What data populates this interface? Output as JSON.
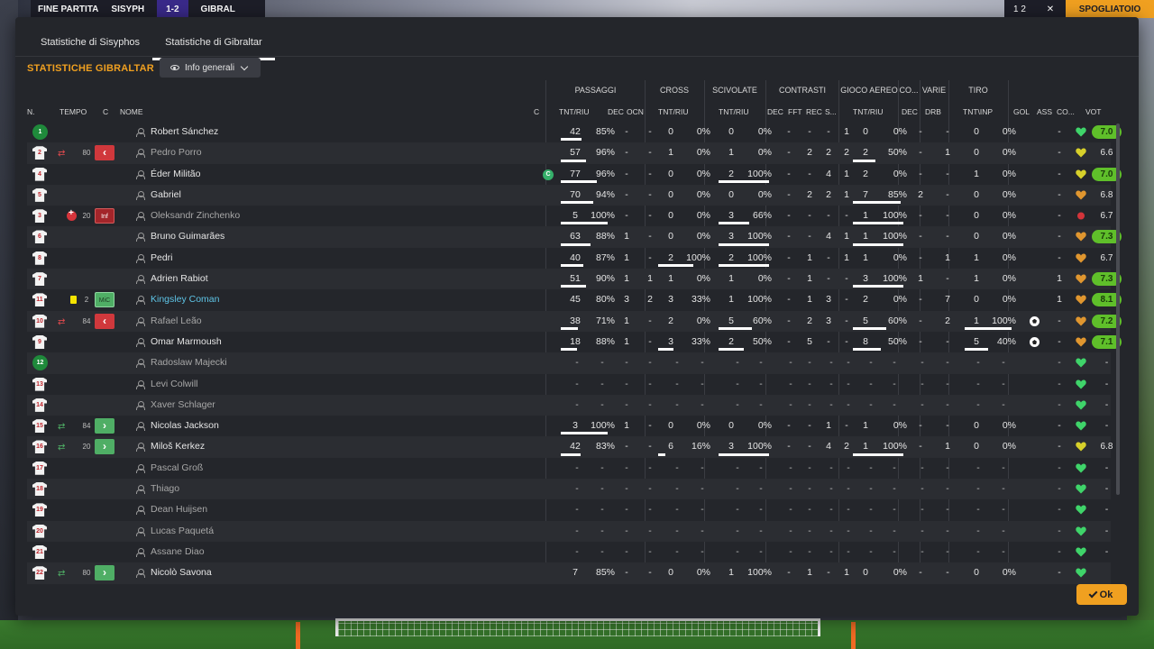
{
  "topbar": {
    "left_label": "FINE PARTITA",
    "home_team_short": "SISYPH",
    "score": "1-2",
    "away_team_short": "GIBRAL",
    "right_counter": "1 2",
    "close_label": "✕",
    "action_label": "SPOGLIATOIO"
  },
  "tabs": [
    {
      "label": "Statistiche di Sisyphos",
      "active": false
    },
    {
      "label": "Statistiche di Gibraltar",
      "active": true
    }
  ],
  "section_title": "STATISTICHE GIBRALTAR",
  "view_dropdown": {
    "label": "Info generali"
  },
  "group_headers": {
    "passaggi": "PASSAGGI",
    "cross": "CROSS",
    "scivolate": "SCIVOLATE",
    "contrasti": "CONTRASTI",
    "gioco_aereo": "GIOCO AEREO",
    "co": "CO...",
    "varie": "VARIE",
    "tiro": "TIRO"
  },
  "columns": {
    "n": "N.",
    "tempo": "TEMPO",
    "c": "C",
    "nome": "NOME",
    "c2": "C",
    "pass_tnt": "TNT/RIU",
    "pass_dec": "DEC",
    "pass_ocn": "OCN",
    "cross_tnt": "TNT/RIU",
    "sciv_tnt": "TNT/RIU",
    "contr_dec": "DEC",
    "contr_fft": "FFT",
    "contr_rec": "REC",
    "contr_s": "S...",
    "aereo_tnt": "TNT/RIU",
    "co_dec": "DEC",
    "varie_drb": "DRB",
    "tiro_tnt": "TNT\\INP",
    "gol": "GOL",
    "ass": "ASS",
    "co2": "CO...",
    "vot": "VOT"
  },
  "players": [
    {
      "num": "1",
      "gk": true,
      "tempo": "",
      "sub": "",
      "c": "",
      "name": "Robert Sánchez",
      "dim": false,
      "p_t": "42",
      "p_p": "85%",
      "p_bar": 0.42,
      "p_dec": "-",
      "p_ocn": "-",
      "cr_t": "0",
      "cr_p": "0%",
      "sc_t": "0",
      "sc_p": "0%",
      "ct_dec": "-",
      "ct_fft": "-",
      "ct_rec": "-",
      "ct_s": "1",
      "ae_t": "0",
      "ae_p": "0%",
      "co_dec": "-",
      "drb": "-",
      "ti_t": "0",
      "ti_p": "0%",
      "gol": "",
      "ass": "-",
      "heart": "green",
      "vot": "7.0",
      "vot_g": true
    },
    {
      "num": "2",
      "gk": false,
      "tempo": "80",
      "sub": "out",
      "c": "red",
      "name": "Pedro Porro",
      "dim": true,
      "p_t": "57",
      "p_p": "96%",
      "p_bar": 0.5,
      "p_dec": "-",
      "p_ocn": "-",
      "cr_t": "1",
      "cr_p": "0%",
      "sc_t": "1",
      "sc_p": "0%",
      "ct_dec": "-",
      "ct_fft": "2",
      "ct_rec": "2",
      "ct_s": "2",
      "ae_t": "2",
      "ae_p": "50%",
      "ae_bar": 0.4,
      "co_dec": "-",
      "drb": "1",
      "ti_t": "0",
      "ti_p": "0%",
      "gol": "",
      "ass": "-",
      "heart": "yellow",
      "vot": "6.6",
      "vot_g": false
    },
    {
      "num": "4",
      "gk": false,
      "tempo": "",
      "sub": "",
      "c": "",
      "name": "Éder Militão",
      "dim": false,
      "capt": true,
      "p_t": "77",
      "p_p": "96%",
      "p_bar": 0.72,
      "p_dec": "-",
      "p_ocn": "-",
      "cr_t": "0",
      "cr_p": "0%",
      "sc_t": "2",
      "sc_p": "100%",
      "sc_bar": 0.9,
      "ct_dec": "-",
      "ct_fft": "-",
      "ct_rec": "4",
      "ct_s": "1",
      "ae_t": "2",
      "ae_p": "0%",
      "co_dec": "-",
      "drb": "-",
      "ti_t": "1",
      "ti_p": "0%",
      "gol": "",
      "ass": "-",
      "heart": "yellow",
      "vot": "7.0",
      "vot_g": true
    },
    {
      "num": "5",
      "gk": false,
      "tempo": "",
      "sub": "",
      "c": "",
      "name": "Gabriel",
      "dim": false,
      "p_t": "70",
      "p_p": "94%",
      "p_bar": 0.65,
      "p_dec": "-",
      "p_ocn": "-",
      "cr_t": "0",
      "cr_p": "0%",
      "sc_t": "0",
      "sc_p": "0%",
      "ct_dec": "-",
      "ct_fft": "2",
      "ct_rec": "2",
      "ct_s": "1",
      "ae_t": "7",
      "ae_p": "85%",
      "ae_bar": 0.85,
      "co_dec": "2",
      "drb": "-",
      "ti_t": "0",
      "ti_p": "0%",
      "gol": "",
      "ass": "-",
      "heart": "orange",
      "vot": "6.8",
      "vot_g": false
    },
    {
      "num": "3",
      "gk": false,
      "tempo": "20",
      "sub": "inj",
      "c": "inf",
      "name": "Oleksandr Zinchenko",
      "dim": true,
      "p_t": "5",
      "p_p": "100%",
      "p_bar": 0.95,
      "p_dec": "-",
      "p_ocn": "-",
      "cr_t": "0",
      "cr_p": "0%",
      "sc_t": "3",
      "sc_p": "66%",
      "sc_bar": 0.55,
      "ct_dec": "-",
      "ct_fft": "-",
      "ct_rec": "-",
      "ct_s": "-",
      "ae_t": "1",
      "ae_p": "100%",
      "ae_bar": 0.9,
      "co_dec": "-",
      "drb": "-",
      "ti_t": "0",
      "ti_p": "0%",
      "gol": "",
      "ass": "-",
      "heart": "red",
      "vot": "6.7",
      "vot_g": false
    },
    {
      "num": "6",
      "gk": false,
      "tempo": "",
      "sub": "",
      "c": "",
      "name": "Bruno Guimarães",
      "dim": false,
      "p_t": "63",
      "p_p": "88%",
      "p_bar": 0.6,
      "p_dec": "1",
      "p_ocn": "-",
      "cr_t": "0",
      "cr_p": "0%",
      "sc_t": "3",
      "sc_p": "100%",
      "sc_bar": 0.9,
      "ct_dec": "-",
      "ct_fft": "-",
      "ct_rec": "4",
      "ct_s": "1",
      "ae_t": "1",
      "ae_p": "100%",
      "ae_bar": 0.9,
      "co_dec": "-",
      "drb": "-",
      "ti_t": "0",
      "ti_p": "0%",
      "gol": "",
      "ass": "-",
      "heart": "orange",
      "vot": "7.3",
      "vot_g": true
    },
    {
      "num": "8",
      "gk": false,
      "tempo": "",
      "sub": "",
      "c": "",
      "name": "Pedri",
      "dim": false,
      "p_t": "40",
      "p_p": "87%",
      "p_bar": 0.45,
      "p_dec": "1",
      "p_ocn": "-",
      "cr_t": "2",
      "cr_p": "100%",
      "cr_bar": 0.7,
      "sc_t": "2",
      "sc_p": "100%",
      "sc_bar": 0.9,
      "ct_dec": "-",
      "ct_fft": "1",
      "ct_rec": "-",
      "ct_s": "1",
      "ae_t": "1",
      "ae_p": "0%",
      "co_dec": "-",
      "drb": "1",
      "ti_t": "1",
      "ti_p": "0%",
      "gol": "",
      "ass": "-",
      "heart": "orange",
      "vot": "6.7",
      "vot_g": false
    },
    {
      "num": "7",
      "gk": false,
      "tempo": "",
      "sub": "",
      "c": "",
      "name": "Adrien Rabiot",
      "dim": false,
      "p_t": "51",
      "p_p": "90%",
      "p_bar": 0.5,
      "p_dec": "1",
      "p_ocn": "1",
      "cr_t": "1",
      "cr_p": "0%",
      "sc_t": "1",
      "sc_p": "0%",
      "ct_dec": "-",
      "ct_fft": "1",
      "ct_rec": "-",
      "ct_s": "-",
      "ae_t": "3",
      "ae_p": "100%",
      "ae_bar": 0.9,
      "co_dec": "1",
      "drb": "-",
      "ti_t": "1",
      "ti_p": "0%",
      "gol": "",
      "ass": "1",
      "heart": "orange",
      "vot": "7.3",
      "vot_g": true
    },
    {
      "num": "11",
      "gk": false,
      "tempo": "2",
      "sub": "yellow",
      "c": "mic",
      "name": "Kingsley Coman",
      "dim": false,
      "hl": true,
      "p_t": "45",
      "p_p": "80%",
      "p_bar": 0.0,
      "p_dec": "3",
      "p_ocn": "2",
      "cr_t": "3",
      "cr_p": "33%",
      "cr_bar": 0.0,
      "sc_t": "1",
      "sc_p": "100%",
      "sc_bar": 0.0,
      "ct_dec": "-",
      "ct_fft": "1",
      "ct_rec": "3",
      "ct_s": "-",
      "ae_t": "2",
      "ae_p": "0%",
      "co_dec": "-",
      "drb": "7",
      "ti_t": "0",
      "ti_p": "0%",
      "gol": "",
      "ass": "1",
      "heart": "orange",
      "vot": "8.1",
      "vot_g": true
    },
    {
      "num": "10",
      "gk": false,
      "tempo": "84",
      "sub": "out",
      "c": "red",
      "name": "Rafael Leão",
      "dim": true,
      "p_t": "38",
      "p_p": "71%",
      "p_bar": 0.35,
      "p_dec": "1",
      "p_ocn": "-",
      "cr_t": "2",
      "cr_p": "0%",
      "sc_t": "5",
      "sc_p": "60%",
      "sc_bar": 0.6,
      "ct_dec": "-",
      "ct_fft": "2",
      "ct_rec": "3",
      "ct_s": "-",
      "ae_t": "5",
      "ae_p": "60%",
      "ae_bar": 0.6,
      "co_dec": "-",
      "drb": "2",
      "ti_t": "1",
      "ti_p": "100%",
      "ti_bar": 0.9,
      "gol": "ball",
      "ass": "-",
      "heart": "orange",
      "vot": "7.2",
      "vot_g": true
    },
    {
      "num": "9",
      "gk": false,
      "tempo": "",
      "sub": "",
      "c": "",
      "name": "Omar Marmoush",
      "dim": false,
      "p_t": "18",
      "p_p": "88%",
      "p_bar": 0.32,
      "p_dec": "1",
      "p_ocn": "-",
      "cr_t": "3",
      "cr_p": "33%",
      "cr_bar": 0.3,
      "sc_t": "2",
      "sc_p": "50%",
      "sc_bar": 0.45,
      "ct_dec": "-",
      "ct_fft": "5",
      "ct_rec": "-",
      "ct_s": "-",
      "ae_t": "8",
      "ae_p": "50%",
      "ae_bar": 0.5,
      "co_dec": "-",
      "drb": "-",
      "ti_t": "5",
      "ti_p": "40%",
      "ti_bar": 0.45,
      "gol": "ball",
      "ass": "-",
      "heart": "orange",
      "vot": "7.1",
      "vot_g": true
    },
    {
      "num": "12",
      "gk": true,
      "tempo": "",
      "sub": "",
      "c": "",
      "name": "Radoslaw Majecki",
      "dim": true,
      "empty": true,
      "heart": "green",
      "vot": "-",
      "vot_g": false
    },
    {
      "num": "13",
      "gk": false,
      "tempo": "",
      "sub": "",
      "c": "",
      "name": "Levi Colwill",
      "dim": true,
      "empty": true,
      "heart": "green",
      "vot": "-",
      "vot_g": false
    },
    {
      "num": "14",
      "gk": false,
      "tempo": "",
      "sub": "",
      "c": "",
      "name": "Xaver Schlager",
      "dim": true,
      "empty": true,
      "heart": "green",
      "vot": "-",
      "vot_g": false
    },
    {
      "num": "15",
      "gk": false,
      "tempo": "84",
      "sub": "in",
      "c": "green",
      "name": "Nicolas Jackson",
      "dim": false,
      "p_t": "3",
      "p_p": "100%",
      "p_bar": 0.95,
      "p_dec": "1",
      "p_ocn": "-",
      "cr_t": "0",
      "cr_p": "0%",
      "sc_t": "0",
      "sc_p": "0%",
      "ct_dec": "-",
      "ct_fft": "-",
      "ct_rec": "1",
      "ct_s": "-",
      "ae_t": "1",
      "ae_p": "0%",
      "co_dec": "-",
      "drb": "-",
      "ti_t": "0",
      "ti_p": "0%",
      "gol": "",
      "ass": "-",
      "heart": "green",
      "vot": "-",
      "vot_g": false
    },
    {
      "num": "16",
      "gk": false,
      "tempo": "20",
      "sub": "in",
      "c": "green",
      "name": "Miloš Kerkez",
      "dim": false,
      "p_t": "42",
      "p_p": "83%",
      "p_bar": 0.4,
      "p_dec": "-",
      "p_ocn": "-",
      "cr_t": "6",
      "cr_p": "16%",
      "cr_bar": 0.15,
      "sc_t": "3",
      "sc_p": "100%",
      "sc_bar": 0.9,
      "ct_dec": "-",
      "ct_fft": "-",
      "ct_rec": "4",
      "ct_s": "2",
      "ae_t": "1",
      "ae_p": "100%",
      "ae_bar": 0.9,
      "co_dec": "-",
      "drb": "1",
      "ti_t": "0",
      "ti_p": "0%",
      "gol": "",
      "ass": "-",
      "heart": "yellow",
      "vot": "6.8",
      "vot_g": false
    },
    {
      "num": "17",
      "gk": false,
      "tempo": "",
      "sub": "",
      "c": "",
      "name": "Pascal Groß",
      "dim": true,
      "empty": true,
      "heart": "green",
      "vot": "-",
      "vot_g": false
    },
    {
      "num": "18",
      "gk": false,
      "tempo": "",
      "sub": "",
      "c": "",
      "name": "Thiago",
      "dim": true,
      "empty": true,
      "heart": "green",
      "vot": "-",
      "vot_g": false
    },
    {
      "num": "19",
      "gk": false,
      "tempo": "",
      "sub": "",
      "c": "",
      "name": "Dean Huijsen",
      "dim": true,
      "empty": true,
      "heart": "green",
      "vot": "-",
      "vot_g": false
    },
    {
      "num": "20",
      "gk": false,
      "tempo": "",
      "sub": "",
      "c": "",
      "name": "Lucas Paquetá",
      "dim": true,
      "empty": true,
      "heart": "green",
      "vot": "-",
      "vot_g": false
    },
    {
      "num": "21",
      "gk": false,
      "tempo": "",
      "sub": "",
      "c": "",
      "name": "Assane Diao",
      "dim": true,
      "empty": true,
      "heart": "green",
      "vot": "-",
      "vot_g": false
    },
    {
      "num": "22",
      "gk": false,
      "tempo": "80",
      "sub": "in",
      "c": "green",
      "name": "Nicolò Savona",
      "dim": false,
      "p_t": "7",
      "p_p": "85%",
      "p_bar": 0.0,
      "p_dec": "-",
      "p_ocn": "-",
      "cr_t": "0",
      "cr_p": "0%",
      "sc_t": "1",
      "sc_p": "100%",
      "sc_bar": 0.0,
      "ct_dec": "-",
      "ct_fft": "1",
      "ct_rec": "-",
      "ct_s": "1",
      "ae_t": "0",
      "ae_p": "0%",
      "co_dec": "-",
      "drb": "-",
      "ti_t": "0",
      "ti_p": "0%",
      "gol": "",
      "ass": "-",
      "heart": "green",
      "vot": "",
      "vot_g": false
    }
  ],
  "ok_button": {
    "label": "Ok"
  },
  "colors": {
    "accent": "#f0a020",
    "rating_green": "#5fbf2a",
    "sub_in": "#4fae65",
    "sub_out": "#d0383c",
    "highlight_name": "#5ec4e6"
  }
}
